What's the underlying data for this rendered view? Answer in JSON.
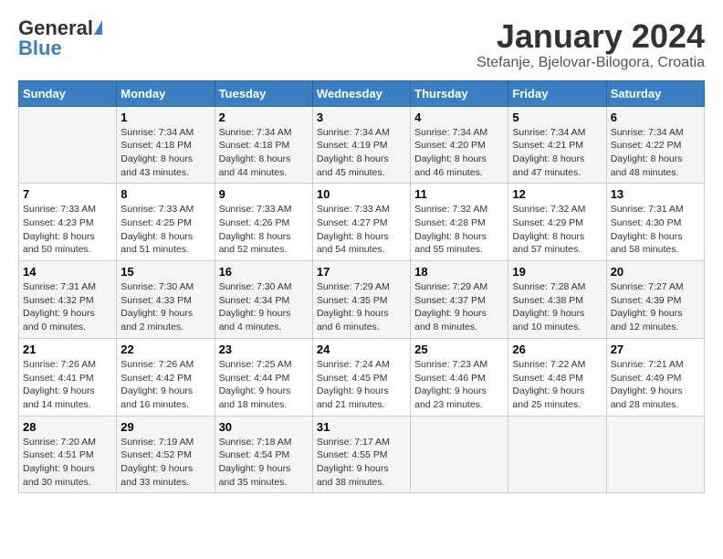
{
  "header": {
    "logo_general": "General",
    "logo_blue": "Blue",
    "title": "January 2024",
    "subtitle": "Stefanje, Bjelovar-Bilogora, Croatia"
  },
  "days_of_week": [
    "Sunday",
    "Monday",
    "Tuesday",
    "Wednesday",
    "Thursday",
    "Friday",
    "Saturday"
  ],
  "weeks": [
    [
      {
        "day": "",
        "info": ""
      },
      {
        "day": "1",
        "info": "Sunrise: 7:34 AM\nSunset: 4:18 PM\nDaylight: 8 hours\nand 43 minutes."
      },
      {
        "day": "2",
        "info": "Sunrise: 7:34 AM\nSunset: 4:18 PM\nDaylight: 8 hours\nand 44 minutes."
      },
      {
        "day": "3",
        "info": "Sunrise: 7:34 AM\nSunset: 4:19 PM\nDaylight: 8 hours\nand 45 minutes."
      },
      {
        "day": "4",
        "info": "Sunrise: 7:34 AM\nSunset: 4:20 PM\nDaylight: 8 hours\nand 46 minutes."
      },
      {
        "day": "5",
        "info": "Sunrise: 7:34 AM\nSunset: 4:21 PM\nDaylight: 8 hours\nand 47 minutes."
      },
      {
        "day": "6",
        "info": "Sunrise: 7:34 AM\nSunset: 4:22 PM\nDaylight: 8 hours\nand 48 minutes."
      }
    ],
    [
      {
        "day": "7",
        "info": "Sunrise: 7:33 AM\nSunset: 4:23 PM\nDaylight: 8 hours\nand 50 minutes."
      },
      {
        "day": "8",
        "info": "Sunrise: 7:33 AM\nSunset: 4:25 PM\nDaylight: 8 hours\nand 51 minutes."
      },
      {
        "day": "9",
        "info": "Sunrise: 7:33 AM\nSunset: 4:26 PM\nDaylight: 8 hours\nand 52 minutes."
      },
      {
        "day": "10",
        "info": "Sunrise: 7:33 AM\nSunset: 4:27 PM\nDaylight: 8 hours\nand 54 minutes."
      },
      {
        "day": "11",
        "info": "Sunrise: 7:32 AM\nSunset: 4:28 PM\nDaylight: 8 hours\nand 55 minutes."
      },
      {
        "day": "12",
        "info": "Sunrise: 7:32 AM\nSunset: 4:29 PM\nDaylight: 8 hours\nand 57 minutes."
      },
      {
        "day": "13",
        "info": "Sunrise: 7:31 AM\nSunset: 4:30 PM\nDaylight: 8 hours\nand 58 minutes."
      }
    ],
    [
      {
        "day": "14",
        "info": "Sunrise: 7:31 AM\nSunset: 4:32 PM\nDaylight: 9 hours\nand 0 minutes."
      },
      {
        "day": "15",
        "info": "Sunrise: 7:30 AM\nSunset: 4:33 PM\nDaylight: 9 hours\nand 2 minutes."
      },
      {
        "day": "16",
        "info": "Sunrise: 7:30 AM\nSunset: 4:34 PM\nDaylight: 9 hours\nand 4 minutes."
      },
      {
        "day": "17",
        "info": "Sunrise: 7:29 AM\nSunset: 4:35 PM\nDaylight: 9 hours\nand 6 minutes."
      },
      {
        "day": "18",
        "info": "Sunrise: 7:29 AM\nSunset: 4:37 PM\nDaylight: 9 hours\nand 8 minutes."
      },
      {
        "day": "19",
        "info": "Sunrise: 7:28 AM\nSunset: 4:38 PM\nDaylight: 9 hours\nand 10 minutes."
      },
      {
        "day": "20",
        "info": "Sunrise: 7:27 AM\nSunset: 4:39 PM\nDaylight: 9 hours\nand 12 minutes."
      }
    ],
    [
      {
        "day": "21",
        "info": "Sunrise: 7:26 AM\nSunset: 4:41 PM\nDaylight: 9 hours\nand 14 minutes."
      },
      {
        "day": "22",
        "info": "Sunrise: 7:26 AM\nSunset: 4:42 PM\nDaylight: 9 hours\nand 16 minutes."
      },
      {
        "day": "23",
        "info": "Sunrise: 7:25 AM\nSunset: 4:44 PM\nDaylight: 9 hours\nand 18 minutes."
      },
      {
        "day": "24",
        "info": "Sunrise: 7:24 AM\nSunset: 4:45 PM\nDaylight: 9 hours\nand 21 minutes."
      },
      {
        "day": "25",
        "info": "Sunrise: 7:23 AM\nSunset: 4:46 PM\nDaylight: 9 hours\nand 23 minutes."
      },
      {
        "day": "26",
        "info": "Sunrise: 7:22 AM\nSunset: 4:48 PM\nDaylight: 9 hours\nand 25 minutes."
      },
      {
        "day": "27",
        "info": "Sunrise: 7:21 AM\nSunset: 4:49 PM\nDaylight: 9 hours\nand 28 minutes."
      }
    ],
    [
      {
        "day": "28",
        "info": "Sunrise: 7:20 AM\nSunset: 4:51 PM\nDaylight: 9 hours\nand 30 minutes."
      },
      {
        "day": "29",
        "info": "Sunrise: 7:19 AM\nSunset: 4:52 PM\nDaylight: 9 hours\nand 33 minutes."
      },
      {
        "day": "30",
        "info": "Sunrise: 7:18 AM\nSunset: 4:54 PM\nDaylight: 9 hours\nand 35 minutes."
      },
      {
        "day": "31",
        "info": "Sunrise: 7:17 AM\nSunset: 4:55 PM\nDaylight: 9 hours\nand 38 minutes."
      },
      {
        "day": "",
        "info": ""
      },
      {
        "day": "",
        "info": ""
      },
      {
        "day": "",
        "info": ""
      }
    ]
  ]
}
